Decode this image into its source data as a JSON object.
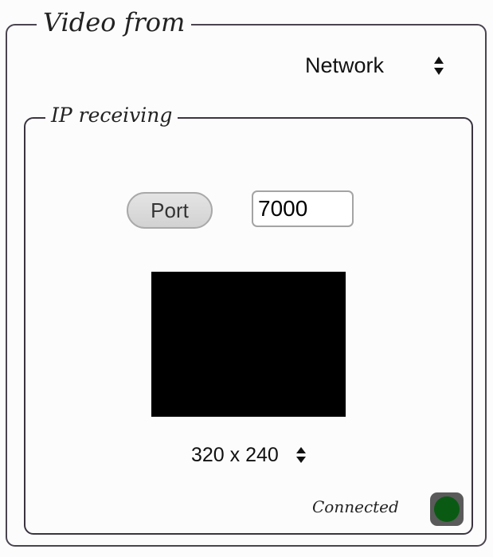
{
  "video_from": {
    "title": "Video from",
    "source_value": "Network"
  },
  "ip_receiving": {
    "title": "IP receiving",
    "port_button_label": "Port",
    "port_value": "7000",
    "resolution_value": "320 x 240",
    "status_label": "Connected",
    "status_color": "#0b5a14"
  }
}
